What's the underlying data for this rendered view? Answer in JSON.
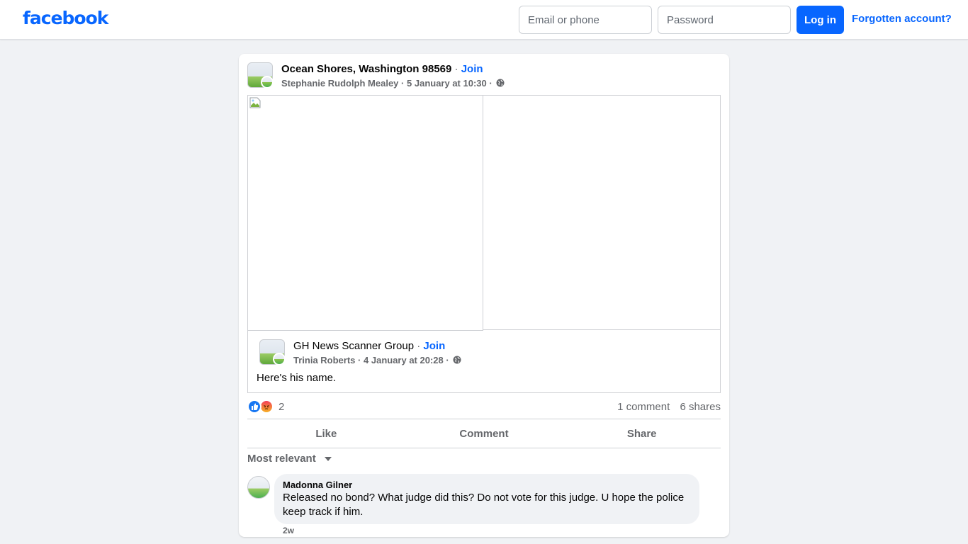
{
  "header": {
    "logo": "facebook",
    "email_placeholder": "Email or phone",
    "password_placeholder": "Password",
    "login_label": "Log in",
    "forgot_label": "Forgotten account?"
  },
  "post": {
    "group_name": "Ocean Shores, Washington 98569",
    "separator": "·",
    "join_label": "Join",
    "author": "Stephanie Rudolph Mealey",
    "timestamp": "5 January at 10:30",
    "meta_sep": "·",
    "shared": {
      "group_name": "GH News Scanner Group",
      "join_label": "Join",
      "author": "Trinia Roberts",
      "timestamp": "4 January at 20:28",
      "text": "Here's his name."
    },
    "reaction_count": "2",
    "reactions": [
      "like-icon",
      "angry-icon"
    ],
    "comment_count": "1 comment",
    "share_count": "6 shares",
    "actions": {
      "like": "Like",
      "comment": "Comment",
      "share": "Share"
    },
    "sort_label": "Most relevant",
    "comments": [
      {
        "author": "Madonna Gilner",
        "text": "Released no bond? What judge did this? Do not vote for this judge. U hope the police keep track if him.",
        "time": "2w"
      }
    ]
  },
  "colors": {
    "brand": "#0866ff",
    "background": "#f0f2f5",
    "secondary_text": "#65676b"
  }
}
